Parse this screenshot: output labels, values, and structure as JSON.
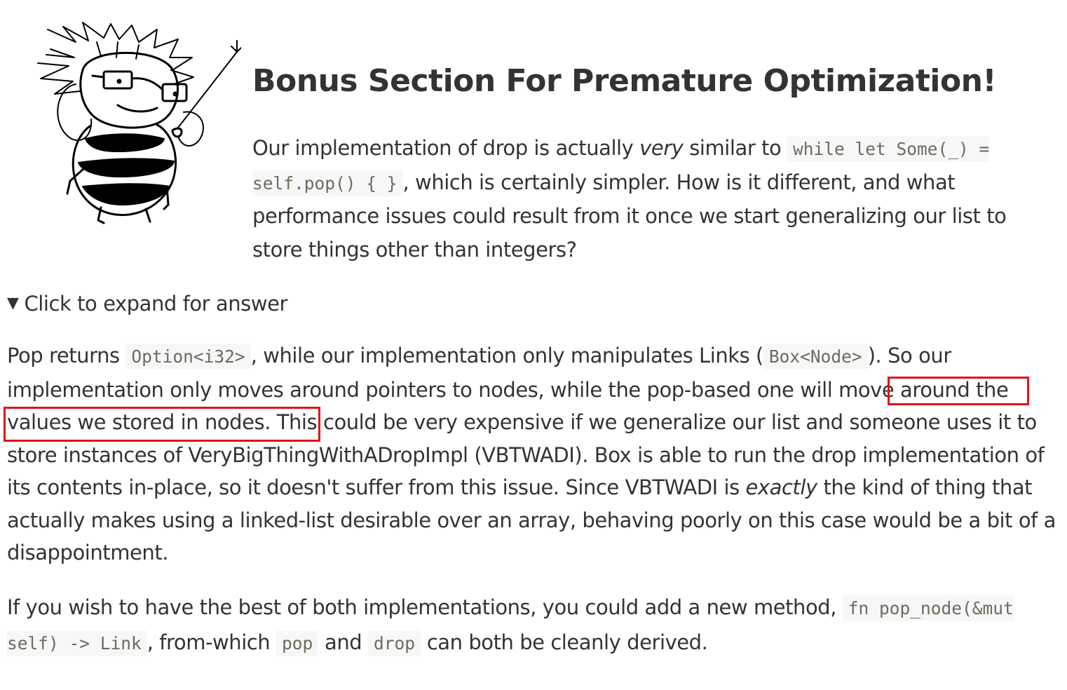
{
  "header": {
    "title": "Bonus Section For Premature Optimization!"
  },
  "intro": {
    "t1": "Our implementation of drop is actually ",
    "em1": "very",
    "t2": " similar to ",
    "code1": "while let Some(_) = self.pop() { }",
    "t3": ", which is certainly simpler. How is it different, and what performance issues could result from it once we start generalizing our list to store things other than integers?"
  },
  "details": {
    "summary": "Click to expand for answer",
    "toggle_icon": "triangle-down-icon"
  },
  "answer1": {
    "t1": "Pop returns ",
    "code1": "Option<i32>",
    "t2": ", while our implementation only manipulates Links (",
    "code2": "Box<Node>",
    "t3": "). So our implementation only moves around pointers to nodes, while the pop-based one will ",
    "hl1": "move around",
    "hl2": "the values we stored in nodes",
    "t4": ". This could be very expensive if we generalize our list and someone uses it to store instances of VeryBigThingWithADropImpl (VBTWADI). Box is able to run the drop implementation of its contents in-place, so it doesn't suffer from this issue. Since VBTWADI is ",
    "em1": "exactly",
    "t5": " the kind of thing that actually makes using a linked-list desirable over an array, behaving poorly on this case would be a bit of a disappointment."
  },
  "answer2": {
    "t1": "If you wish to have the best of both implementations, you could add a new method, ",
    "code1": "fn pop_node(&mut self) -> Link",
    "t2": ", from-which ",
    "code2": "pop",
    "t3": " and ",
    "code3": "drop",
    "t4": " can both be cleanly derived."
  },
  "colors": {
    "text": "#333333",
    "code_text": "#6e6b5e",
    "code_bg": "#f6f7f6",
    "highlight_border": "#e0131a"
  }
}
